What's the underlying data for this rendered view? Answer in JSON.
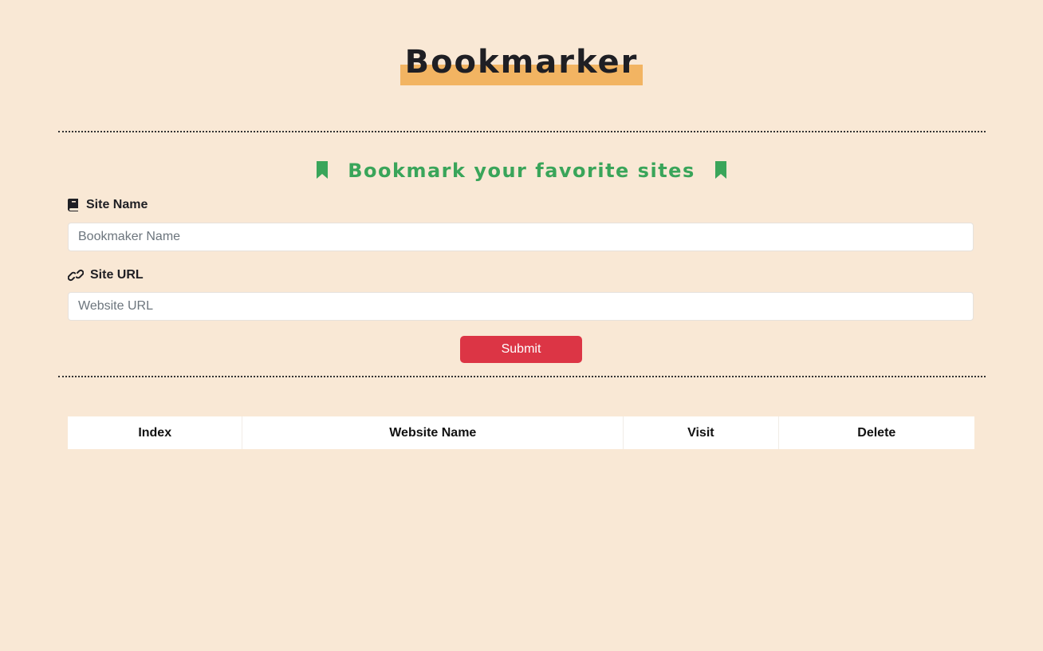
{
  "header": {
    "title": "Bookmarker",
    "highlight_color": "#f2b462"
  },
  "form": {
    "heading": "Bookmark your favorite sites",
    "heading_icon": "bookmark-icon",
    "heading_color": "#3aa55a",
    "site_name": {
      "label": "Site Name",
      "icon": "book-icon",
      "placeholder": "Bookmaker Name",
      "value": ""
    },
    "site_url": {
      "label": "Site URL",
      "icon": "link-icon",
      "placeholder": "Website URL",
      "value": ""
    },
    "submit_label": "Submit",
    "submit_color": "#dc3545"
  },
  "table": {
    "columns": [
      "Index",
      "Website Name",
      "Visit",
      "Delete"
    ],
    "rows": []
  },
  "theme": {
    "background": "#f9e8d5"
  }
}
